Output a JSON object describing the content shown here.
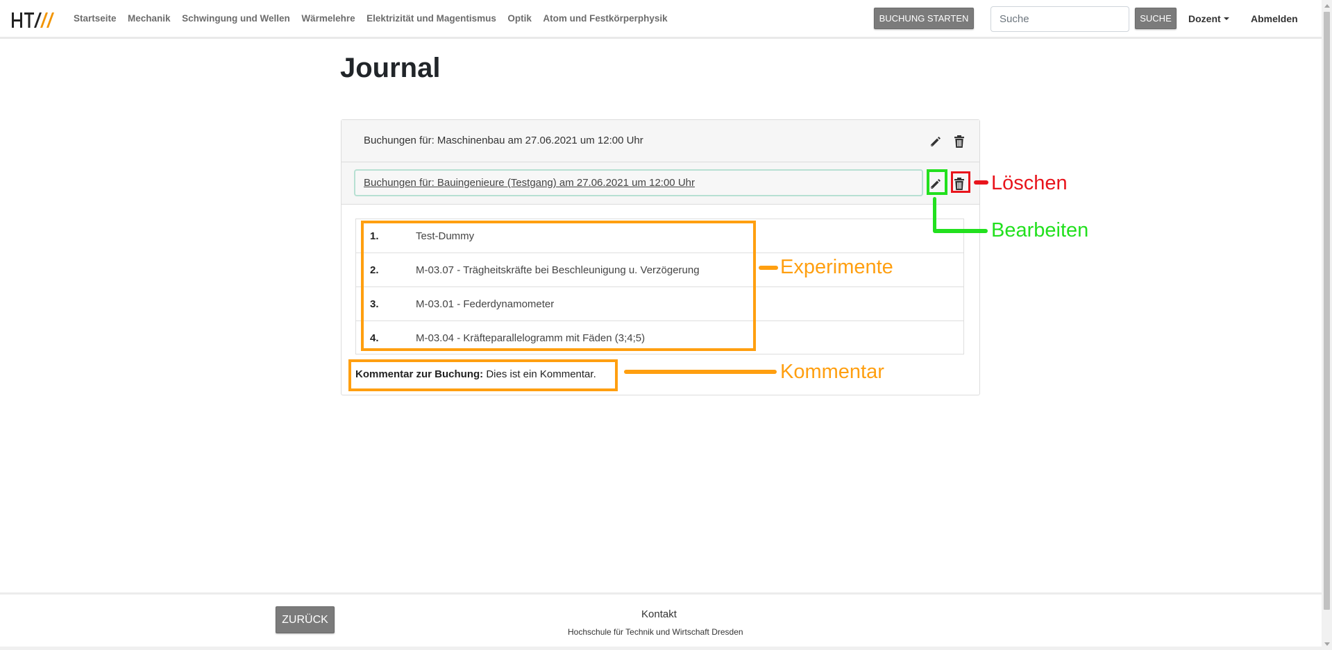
{
  "nav": {
    "logo_text": "HTW",
    "links": [
      "Startseite",
      "Mechanik",
      "Schwingung und Wellen",
      "Wärmelehre",
      "Elektrizität und Magentismus",
      "Optik",
      "Atom und Festkörperphysik"
    ],
    "buchung_button": "BUCHUNG STARTEN",
    "search_placeholder": "Suche",
    "search_button": "SUCHE",
    "user_menu": "Dozent",
    "logout": "Abmelden"
  },
  "page": {
    "title": "Journal"
  },
  "bookings": [
    {
      "label": "Buchungen für: Maschinenbau am 27.06.2021 um 12:00 Uhr"
    },
    {
      "label": "Buchungen für: Bauingenieure (Testgang) am 27.06.2021 um 12:00 Uhr"
    }
  ],
  "experiments": [
    {
      "num": "1.",
      "name": "Test-Dummy"
    },
    {
      "num": "2.",
      "name": "M-03.07 - Trägheitskräfte bei Beschleunigung u. Verzögerung"
    },
    {
      "num": "3.",
      "name": "M-03.01 - Federdynamometer"
    },
    {
      "num": "4.",
      "name": "M-03.04 - Kräfteparallelogramm mit Fäden (3;4;5)"
    }
  ],
  "comment": {
    "label": "Kommentar zur Buchung:",
    "text": " Dies ist ein Kommentar."
  },
  "annotations": {
    "loeschen": "Löschen",
    "bearbeiten": "Bearbeiten",
    "experimente": "Experimente",
    "kommentar": "Kommentar",
    "colors": {
      "red": "#e8141c",
      "green": "#22e01e",
      "orange": "#ff9f10"
    }
  },
  "footer": {
    "back_button": "ZURÜCK",
    "kontakt": "Kontakt",
    "institution": "Hochschule für Technik und Wirtschaft Dresden"
  },
  "icons": [
    "pencil-icon",
    "trash-icon",
    "chevron-down-icon"
  ]
}
